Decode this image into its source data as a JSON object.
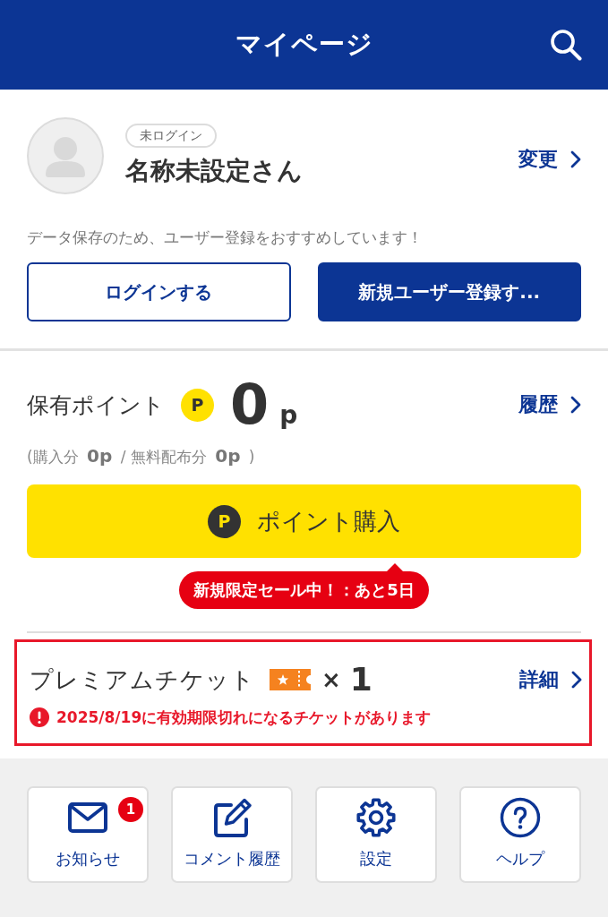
{
  "header": {
    "title": "マイページ"
  },
  "profile": {
    "status_badge": "未ログイン",
    "name": "名称未設定さん",
    "edit_link": "変更",
    "message": "データ保存のため、ユーザー登録をおすすめしています！",
    "buttons": [
      {
        "label": "ログインする",
        "kind": "outline"
      },
      {
        "label": "新規ユーザー登録す...",
        "kind": "filled"
      }
    ]
  },
  "points": {
    "label": "保有ポイント",
    "coin_symbol": "P",
    "amount": "0",
    "unit": "p",
    "history_link": "履歴",
    "breakdown": "(購入分 **0p** / 無料配布分 **0p** )",
    "purchase_button": {
      "coin_symbol": "P",
      "label": "ポイント購入"
    },
    "sale_tooltip": "新規限定セール中！：あと5日"
  },
  "ticket": {
    "highlighted": true,
    "label": "プレミアムチケット",
    "multiplier": "×",
    "count": "1",
    "detail_link": "詳細",
    "warning": "2025/8/19に有効期限切れになるチケットがあります"
  },
  "shortcuts": [
    {
      "kind": "mail",
      "label": "お知らせ",
      "badge": "1"
    },
    {
      "kind": "edit",
      "label": "コメント履歴"
    },
    {
      "kind": "settings",
      "label": "設定"
    },
    {
      "kind": "help",
      "label": "ヘルプ"
    }
  ]
}
